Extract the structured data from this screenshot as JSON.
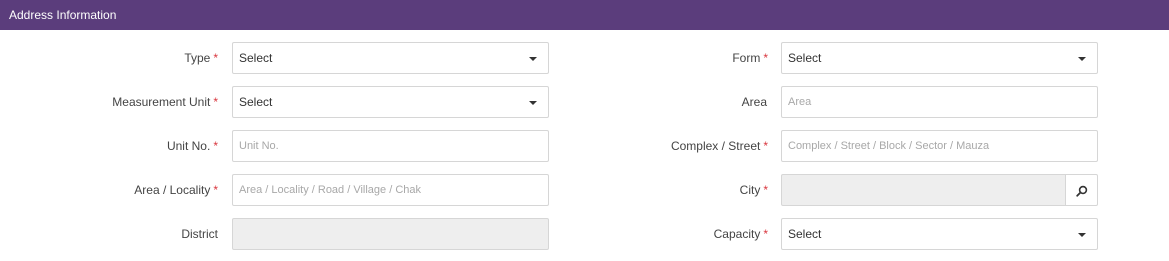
{
  "header": {
    "title": "Address Information"
  },
  "required_mark": "*",
  "left": {
    "type": {
      "label": "Type",
      "value": "Select"
    },
    "measurement_unit": {
      "label": "Measurement Unit",
      "value": "Select"
    },
    "unit_no": {
      "label": "Unit No.",
      "placeholder": "Unit No."
    },
    "area_locality": {
      "label": "Area / Locality",
      "placeholder": "Area / Locality / Road / Village / Chak"
    },
    "district": {
      "label": "District",
      "value": ""
    }
  },
  "right": {
    "form": {
      "label": "Form",
      "value": "Select"
    },
    "area": {
      "label": "Area",
      "placeholder": "Area"
    },
    "complex_street": {
      "label": "Complex / Street",
      "placeholder": "Complex / Street / Block / Sector / Mauza"
    },
    "city": {
      "label": "City",
      "value": "",
      "search_icon": "search-icon"
    },
    "capacity": {
      "label": "Capacity",
      "value": "Select"
    }
  },
  "colors": {
    "header_bg": "#5b3d7c",
    "required": "#d9363e",
    "disabled_bg": "#eeeeee"
  }
}
